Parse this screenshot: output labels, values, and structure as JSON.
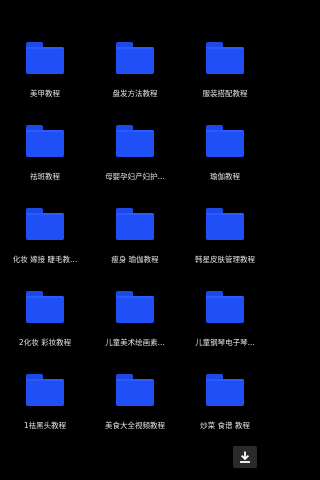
{
  "folders": [
    {
      "label": "美甲教程"
    },
    {
      "label": "盘发方法教程"
    },
    {
      "label": "服装搭配教程"
    },
    {
      "label": "祛斑教程"
    },
    {
      "label": "母婴孕妇产妇护..."
    },
    {
      "label": "瑜伽教程"
    },
    {
      "label": "化妆 嫁接 睫毛教..."
    },
    {
      "label": "瘦身 瑜伽教程"
    },
    {
      "label": "韩星皮肤管理教程"
    },
    {
      "label": "2化妆 彩妆教程"
    },
    {
      "label": "儿童美术绘画素..."
    },
    {
      "label": "儿童钢琴电子琴..."
    },
    {
      "label": "1祛黑头教程"
    },
    {
      "label": "美食大全视频教程"
    },
    {
      "label": "炒菜 食谱 教程"
    }
  ],
  "colors": {
    "background": "#000000",
    "folder": "#1f4ff5",
    "label": "#e6e6e6",
    "download_button": "#2a2a2a"
  },
  "icons": {
    "folder": "folder-icon",
    "download": "download-icon"
  }
}
